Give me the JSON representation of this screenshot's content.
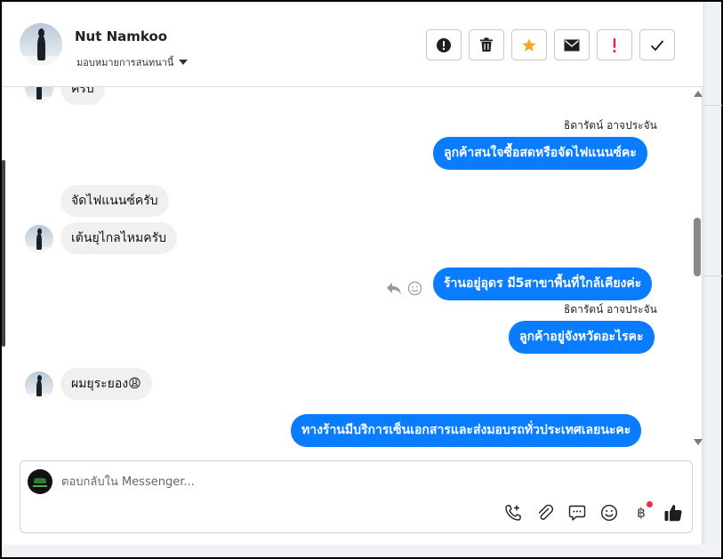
{
  "header": {
    "contact_name": "Nut Namkoo",
    "assign_label": "มอบหมายการสนทนานี้",
    "actions": [
      {
        "name": "spam-button",
        "icon": "exclamation-circle-icon"
      },
      {
        "name": "delete-button",
        "icon": "trash-icon"
      },
      {
        "name": "star-button",
        "icon": "star-icon"
      },
      {
        "name": "mark-unread-button",
        "icon": "envelope-icon"
      },
      {
        "name": "follow-up-button",
        "icon": "exclamation-icon"
      },
      {
        "name": "done-button",
        "icon": "checkmark-icon"
      }
    ],
    "star_color": "#f5a623",
    "followup_color": "#e41e3f"
  },
  "messages": {
    "m0": "ครับ",
    "s1": "ธิดารัตน์ อาจประจัน",
    "m1": "ลูกค้าสนใจซื้อสดหรือจัดไฟแนนซ์คะ",
    "m2": "จัดไฟแนนซ์ครับ",
    "m3": "เต้นยุไกลไหมครับ",
    "m4": "ร้านอยู่อุดร มี5สาขาพื้นที่ใกล้เคียงค่ะ",
    "s2": "ธิดารัตน์ อาจประจัน",
    "m5": "ลูกค้าอยู่จังหวัดอะไรคะ",
    "m6": "ผมยุระยอง😩",
    "m7": "ทางร้านมีบริการเซ็นเอกสารและส่งมอบรถทั่วประเทศเลยนะคะ"
  },
  "composer": {
    "placeholder": "ตอบกลับใน Messenger...",
    "tools": [
      "phone-add-icon",
      "paperclip-icon",
      "chat-bubble-icon",
      "smiley-icon",
      "baht-icon",
      "thumbs-up-icon"
    ],
    "baht_symbol": "฿"
  },
  "colors": {
    "outgoing_bubble": "#0a7cff",
    "incoming_bubble": "#f0f0f0"
  }
}
